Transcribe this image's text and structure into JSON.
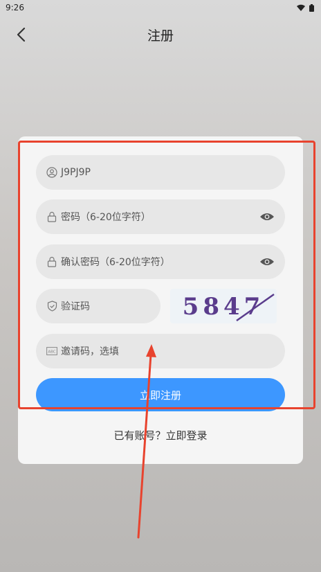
{
  "status_bar": {
    "time": "9:26"
  },
  "nav": {
    "title": "注册"
  },
  "form": {
    "username_value": "J9PJ9P",
    "password_placeholder": "密码（6-20位字符）",
    "confirm_placeholder": "确认密码（6-20位字符）",
    "captcha_placeholder": "验证码",
    "captcha_image_text": "5847",
    "invite_placeholder": "邀请码，选填",
    "submit_label": "立即注册",
    "login_link": "已有账号？立即登录"
  },
  "colors": {
    "accent": "#3d97ff",
    "annotation": "#e8432e",
    "captcha_text": "#5a3c8c"
  },
  "icons": [
    "back-arrow-icon",
    "wifi-icon",
    "battery-icon",
    "user-icon",
    "lock-icon",
    "eye-icon",
    "shield-icon",
    "abc-icon"
  ]
}
